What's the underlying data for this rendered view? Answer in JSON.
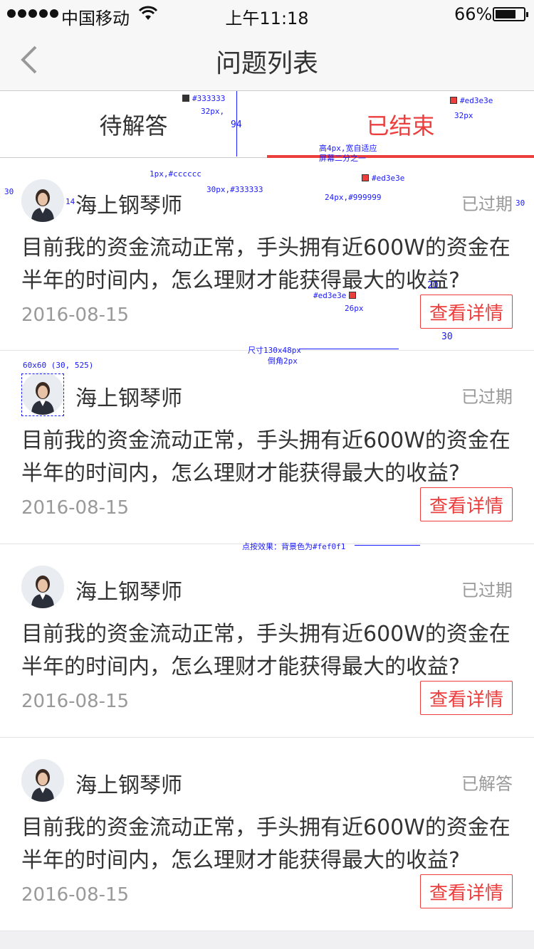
{
  "status_bar": {
    "carrier": "中国移动",
    "time": "上午11:18",
    "battery": "66%"
  },
  "nav": {
    "title": "问题列表"
  },
  "tabs": [
    {
      "label": "待解答",
      "active": false
    },
    {
      "label": "已结束",
      "active": true
    }
  ],
  "cards": [
    {
      "name": "海上钢琴师",
      "status": "已过期",
      "question": "目前我的资金流动正常，手头拥有近600W的资金在半年的时间内，怎么理财才能获得最大的收益?",
      "date": "2016-08-15",
      "button": "查看详情"
    },
    {
      "name": "海上钢琴师",
      "status": "已过期",
      "question": "目前我的资金流动正常，手头拥有近600W的资金在半年的时间内，怎么理财才能获得最大的收益?",
      "date": "2016-08-15",
      "button": "查看详情"
    },
    {
      "name": "海上钢琴师",
      "status": "已过期",
      "question": "目前我的资金流动正常，手头拥有近600W的资金在半年的时间内，怎么理财才能获得最大的收益?",
      "date": "2016-08-15",
      "button": "查看详情"
    },
    {
      "name": "海上钢琴师",
      "status": "已解答",
      "question": "目前我的资金流动正常，手头拥有近600W的资金在半年的时间内，怎么理财才能获得最大的收益?",
      "date": "2016-08-15",
      "button": "查看详情"
    }
  ],
  "annotations": {
    "tab_color": "#333333",
    "tab_size": "32px,",
    "tab_height": "94",
    "active_color": "#ed3e3e",
    "active_size": "32px",
    "underline_spec": "高4px,宽自适应",
    "underline_spec2": "屏幕二分之一",
    "underline_color": "#ed3e3e",
    "divider_spec": "1px,#cccccc",
    "margin_left": "30",
    "avatar_gap": "14",
    "name_spec": "30px,#333333",
    "status_spec": "24px,#999999",
    "margin_right": "30",
    "btn_top": "20",
    "btn_color": "#ed3e3e",
    "btn_font": "26px",
    "btn_bottom": "30",
    "btn_size": "尺寸130x48px",
    "btn_radius": "倒角2px",
    "avatar_spec": "60x60 (30, 525)",
    "press_effect": "点按效果：背景色为#fef0f1"
  },
  "colors": {
    "accent": "#ed3e3e",
    "text": "#333333",
    "muted": "#999999",
    "divider": "#cccccc",
    "press_bg": "#fef0f1"
  }
}
